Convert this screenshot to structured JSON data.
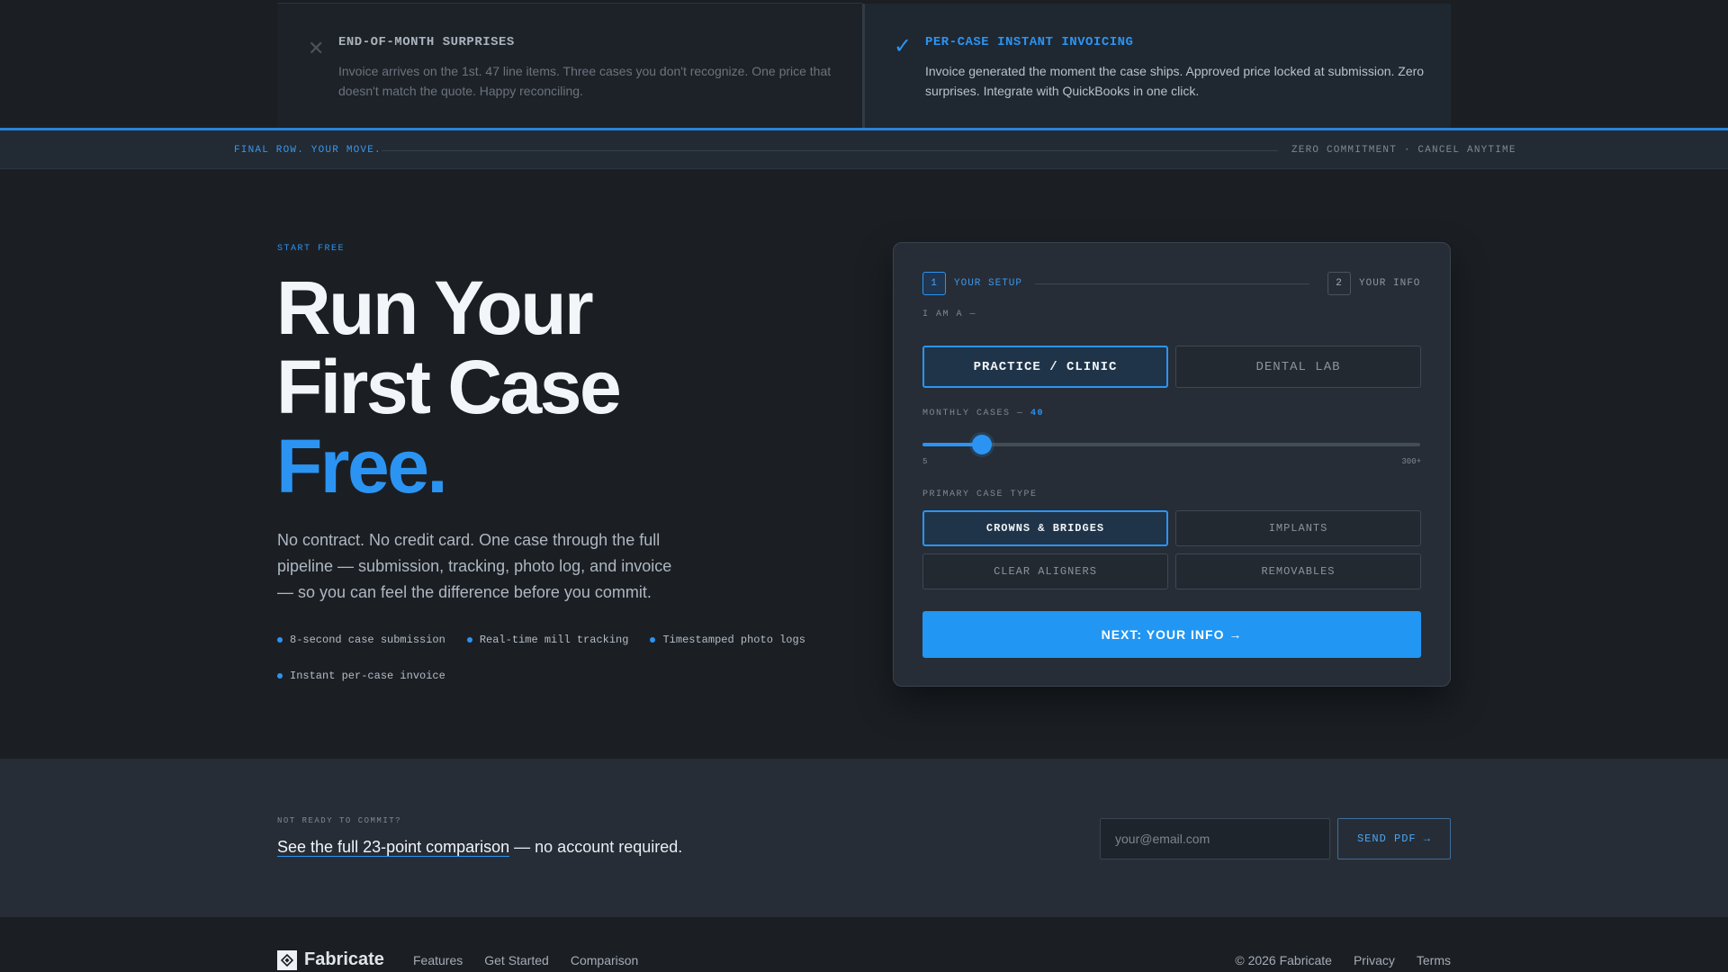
{
  "comparison": {
    "old": {
      "icon": "x-icon",
      "title": "END-OF-MONTH SURPRISES",
      "description": "Invoice arrives on the 1st. 47 line items. Three cases you don't recognize. One price that doesn't match the quote. Happy reconciling."
    },
    "new": {
      "icon": "check-icon",
      "title": "PER-CASE INSTANT INVOICING",
      "description": "Invoice generated the moment the case ships. Approved price locked at submission. Zero surprises. Integrate with QuickBooks in one click."
    }
  },
  "band": {
    "left": "FINAL ROW. YOUR MOVE.",
    "right": "ZERO COMMITMENT · CANCEL ANYTIME"
  },
  "hero": {
    "eyebrow": "START FREE",
    "title_line1": "Run Your",
    "title_line2": "First Case",
    "title_line3": "Free.",
    "description": "No contract. No credit card. One case through the full pipeline — submission, tracking, photo log, and invoice — so you can feel the difference before you commit.",
    "features": [
      "8-second case submission",
      "Real-time mill tracking",
      "Timestamped photo logs",
      "Instant per-case invoice"
    ]
  },
  "setup_card": {
    "steps": [
      {
        "number": "1",
        "label": "YOUR SETUP",
        "active": true
      },
      {
        "number": "2",
        "label": "YOUR INFO",
        "active": false
      }
    ],
    "role_label": "I AM A —",
    "roles": [
      {
        "label": "PRACTICE / CLINIC",
        "selected": true
      },
      {
        "label": "DENTAL LAB",
        "selected": false
      }
    ],
    "cases_label": "MONTHLY CASES —",
    "cases_value": "40",
    "slider": {
      "min": 5,
      "max": 300,
      "value": 40,
      "min_label": "5",
      "max_label": "300+"
    },
    "case_type_label": "PRIMARY CASE TYPE",
    "case_types": [
      {
        "label": "CROWNS & BRIDGES",
        "selected": true
      },
      {
        "label": "IMPLANTS",
        "selected": false
      },
      {
        "label": "CLEAR ALIGNERS",
        "selected": false
      },
      {
        "label": "REMOVABLES",
        "selected": false
      }
    ],
    "cta_label": "NEXT: YOUR INFO →"
  },
  "newsletter": {
    "eyebrow": "NOT READY TO COMMIT?",
    "link_text": "See the full 23-point comparison",
    "suffix": " — no account required.",
    "email_placeholder": "your@email.com",
    "email_value": "",
    "button_label": "SEND PDF →"
  },
  "footer": {
    "brand": "Fabricate",
    "logo_icon": "diamond-logo-icon",
    "nav": [
      "Features",
      "Get Started",
      "Comparison"
    ],
    "copyright": "© 2026 Fabricate",
    "links": [
      "Privacy",
      "Terms"
    ]
  },
  "colors": {
    "accent": "#2196f3",
    "background": "#1b1f24",
    "card": "#262d36"
  }
}
